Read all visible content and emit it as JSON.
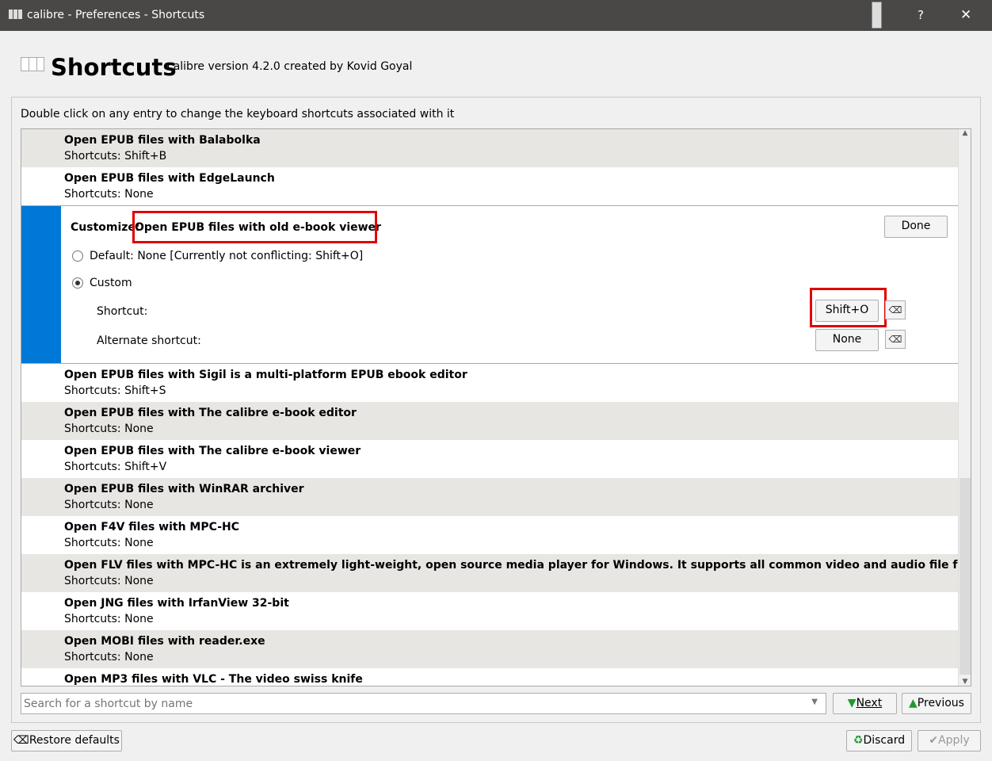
{
  "window": {
    "title": "calibre - Preferences - Shortcuts",
    "help": "?",
    "close": "✕"
  },
  "header": {
    "title": "Shortcuts",
    "subtitle": "calibre version 4.2.0 created by Kovid Goyal"
  },
  "instruction": "Double click on any entry to change the keyboard shortcuts associated with it",
  "rows_before": [
    {
      "name": "Open EPUB files with Balabolka",
      "shortcut": "Shortcuts: Shift+B"
    },
    {
      "name": "Open EPUB files with EdgeLaunch",
      "shortcut": "Shortcuts: None"
    }
  ],
  "editor": {
    "customize_label": "Customize:",
    "name": "Open EPUB files with old e-book viewer",
    "done": "Done",
    "default_label": "Default: None [Currently not conflicting: Shift+O]",
    "custom_label": "Custom",
    "shortcut_label": "Shortcut:",
    "shortcut_value": "Shift+O",
    "alternate_label": "Alternate shortcut:",
    "alternate_value": "None",
    "selected": "custom"
  },
  "rows_after": [
    {
      "name": "Open EPUB files with Sigil is a multi-platform EPUB ebook editor",
      "shortcut": "Shortcuts: Shift+S"
    },
    {
      "name": "Open EPUB files with The calibre e-book editor",
      "shortcut": "Shortcuts: None"
    },
    {
      "name": "Open EPUB files with The calibre e-book viewer",
      "shortcut": "Shortcuts: Shift+V"
    },
    {
      "name": "Open EPUB files with WinRAR archiver",
      "shortcut": "Shortcuts: None"
    },
    {
      "name": "Open F4V files with MPC-HC",
      "shortcut": "Shortcuts: None"
    },
    {
      "name": "Open FLV files with MPC-HC is an extremely light-weight, open source media player for Windows. It supports all common video and audio file formats available for playback",
      "shortcut": "Shortcuts: None"
    },
    {
      "name": "Open JNG files with IrfanView 32-bit",
      "shortcut": "Shortcuts: None"
    },
    {
      "name": "Open MOBI files with reader.exe",
      "shortcut": "Shortcuts: None"
    },
    {
      "name": "Open MP3 files with VLC - The video swiss knife",
      "shortcut": ""
    }
  ],
  "search": {
    "placeholder": "Search for a shortcut by name",
    "next": "Next",
    "previous": "Previous"
  },
  "footer": {
    "restore": "Restore defaults",
    "discard": "Discard",
    "apply": "Apply"
  },
  "colors": {
    "accent": "#0078d7",
    "highlight": "#e00000",
    "titlebar": "#4a4847"
  }
}
